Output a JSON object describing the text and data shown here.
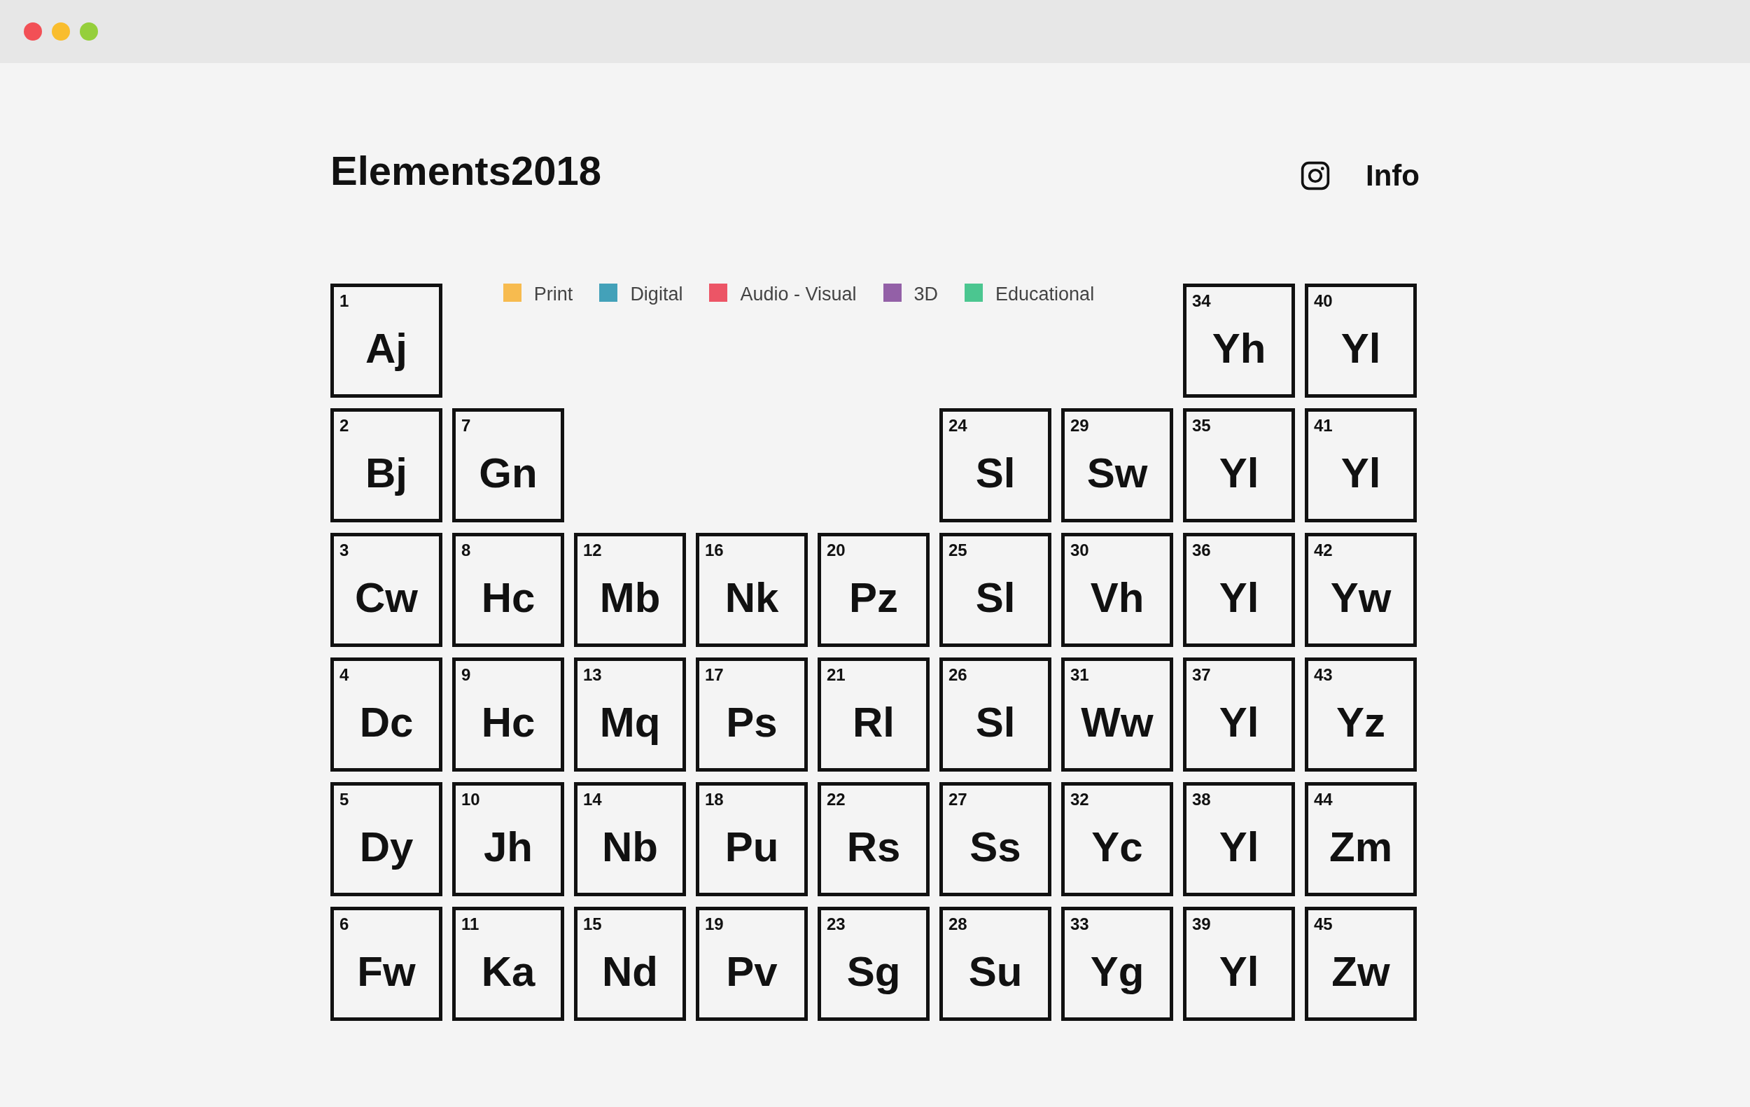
{
  "title": "Elements2018",
  "nav": {
    "info": "Info"
  },
  "legend": [
    {
      "label": "Print",
      "color": "#f7bb4f"
    },
    {
      "label": "Digital",
      "color": "#43a1b9"
    },
    {
      "label": "Audio - Visual",
      "color": "#ec5566"
    },
    {
      "label": "3D",
      "color": "#9360a7"
    },
    {
      "label": "Educational",
      "color": "#4bc690"
    }
  ],
  "columns": [
    [
      {
        "number": "1",
        "symbol": "Aj"
      },
      {
        "number": "2",
        "symbol": "Bj"
      },
      {
        "number": "3",
        "symbol": "Cw"
      },
      {
        "number": "4",
        "symbol": "Dc"
      },
      {
        "number": "5",
        "symbol": "Dy"
      },
      {
        "number": "6",
        "symbol": "Fw"
      }
    ],
    [
      {
        "number": "7",
        "symbol": "Gn"
      },
      {
        "number": "8",
        "symbol": "Hc"
      },
      {
        "number": "9",
        "symbol": "Hc"
      },
      {
        "number": "10",
        "symbol": "Jh"
      },
      {
        "number": "11",
        "symbol": "Ka"
      }
    ],
    [
      {
        "number": "12",
        "symbol": "Mb"
      },
      {
        "number": "13",
        "symbol": "Mq"
      },
      {
        "number": "14",
        "symbol": "Nb"
      },
      {
        "number": "15",
        "symbol": "Nd"
      }
    ],
    [
      {
        "number": "16",
        "symbol": "Nk"
      },
      {
        "number": "17",
        "symbol": "Ps"
      },
      {
        "number": "18",
        "symbol": "Pu"
      },
      {
        "number": "19",
        "symbol": "Pv"
      }
    ],
    [
      {
        "number": "20",
        "symbol": "Pz"
      },
      {
        "number": "21",
        "symbol": "Rl"
      },
      {
        "number": "22",
        "symbol": "Rs"
      },
      {
        "number": "23",
        "symbol": "Sg"
      }
    ],
    [
      {
        "number": "24",
        "symbol": "Sl"
      },
      {
        "number": "25",
        "symbol": "Sl"
      },
      {
        "number": "26",
        "symbol": "Sl"
      },
      {
        "number": "27",
        "symbol": "Ss"
      },
      {
        "number": "28",
        "symbol": "Su"
      }
    ],
    [
      {
        "number": "29",
        "symbol": "Sw"
      },
      {
        "number": "30",
        "symbol": "Vh"
      },
      {
        "number": "31",
        "symbol": "Ww"
      },
      {
        "number": "32",
        "symbol": "Yc"
      },
      {
        "number": "33",
        "symbol": "Yg"
      }
    ],
    [
      {
        "number": "34",
        "symbol": "Yh"
      },
      {
        "number": "35",
        "symbol": "Yl"
      },
      {
        "number": "36",
        "symbol": "Yl"
      },
      {
        "number": "37",
        "symbol": "Yl"
      },
      {
        "number": "38",
        "symbol": "Yl"
      },
      {
        "number": "39",
        "symbol": "Yl"
      }
    ],
    [
      {
        "number": "40",
        "symbol": "Yl"
      },
      {
        "number": "41",
        "symbol": "Yl"
      },
      {
        "number": "42",
        "symbol": "Yw"
      },
      {
        "number": "43",
        "symbol": "Yz"
      },
      {
        "number": "44",
        "symbol": "Zm"
      },
      {
        "number": "45",
        "symbol": "Zw"
      }
    ]
  ]
}
